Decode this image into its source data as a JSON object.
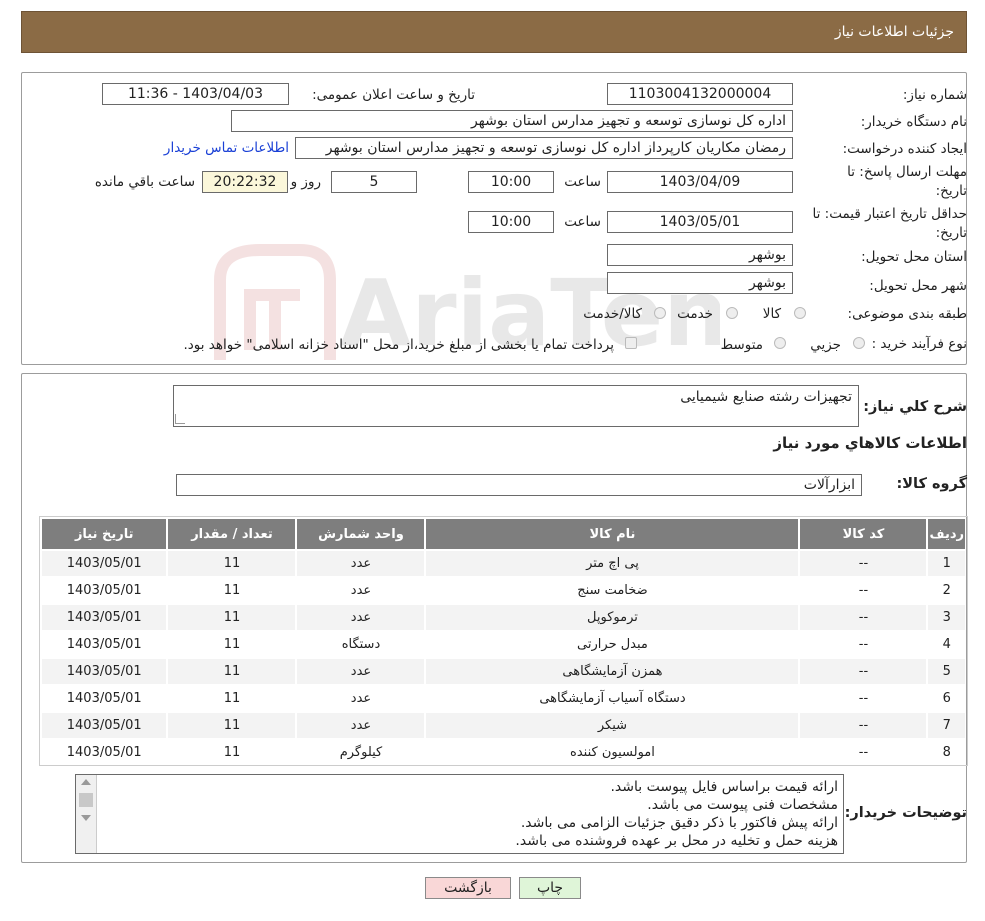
{
  "header": {
    "title": "جزئیات اطلاعات نیاز"
  },
  "form": {
    "need_number_label": "شماره نیاز:",
    "need_number": "1103004132000004",
    "announce_label": "تاریخ و ساعت اعلان عمومی:",
    "announce_value": "1403/04/03 - 11:36",
    "buyer_org_label": "نام دستگاه خریدار:",
    "buyer_org": "اداره کل نوسازی  توسعه و تجهیز مدارس استان بوشهر",
    "requester_label": "ایجاد کننده درخواست:",
    "requester": "رمضان مکاریان کارپرداز اداره کل نوسازی  توسعه و تجهیز مدارس استان بوشهر",
    "contact_link": "اطلاعات تماس خریدار",
    "deadline_label_1": "مهلت ارسال پاسخ: تا",
    "deadline_label_2": "تاریخ:",
    "deadline_date": "1403/04/09",
    "time_label": "ساعت",
    "deadline_time": "10:00",
    "days_value": "5",
    "days_label": "روز و",
    "remaining_time": "20:22:32",
    "remaining_label": "ساعت باقي مانده",
    "min_price_label_1": "حداقل تاریخ اعتبار قیمت: تا",
    "min_price_label_2": "تاریخ:",
    "min_price_date": "1403/05/01",
    "min_price_time": "10:00",
    "province_label": "استان محل تحویل:",
    "province": "بوشهر",
    "city_label": "شهر محل تحویل:",
    "city": "بوشهر",
    "category_label": "طبقه بندی موضوعی:",
    "category_options": [
      "کالا",
      "خدمت",
      "کالا/خدمت"
    ],
    "process_label": "نوع فرآیند خرید :",
    "process_options": [
      "جزیي",
      "متوسط"
    ],
    "process_note": "پرداخت تمام یا بخشی از مبلغ خرید،از محل \"اسناد خزانه اسلامی\" خواهد بود."
  },
  "details": {
    "general_label": "شرح کلي نیاز:",
    "general_value": "تجهیزات رشته صنایع شیمیایی",
    "goods_info_title": "اطلاعات کالاهاي مورد نیاز",
    "group_label": "گروه کالا:",
    "group_value": "ابزارآلات"
  },
  "table": {
    "headers": [
      "ردیف",
      "کد کالا",
      "نام کالا",
      "واحد شمارش",
      "تعداد / مقدار",
      "تاریخ نیاز"
    ],
    "rows": [
      [
        "1",
        "--",
        "پی اچ متر",
        "عدد",
        "11",
        "1403/05/01"
      ],
      [
        "2",
        "--",
        "ضخامت سنج",
        "عدد",
        "11",
        "1403/05/01"
      ],
      [
        "3",
        "--",
        "ترموکوپل",
        "عدد",
        "11",
        "1403/05/01"
      ],
      [
        "4",
        "--",
        "مبدل حرارتی",
        "دستگاه",
        "11",
        "1403/05/01"
      ],
      [
        "5",
        "--",
        "همزن آزمایشگاهی",
        "عدد",
        "11",
        "1403/05/01"
      ],
      [
        "6",
        "--",
        "دستگاه آسیاب آزمایشگاهی",
        "عدد",
        "11",
        "1403/05/01"
      ],
      [
        "7",
        "--",
        "شیکر",
        "عدد",
        "11",
        "1403/05/01"
      ],
      [
        "8",
        "--",
        "امولسیون کننده",
        "کیلوگرم",
        "11",
        "1403/05/01"
      ]
    ]
  },
  "buyer_notes": {
    "label": "توضیحات خریدار:",
    "lines": [
      "ارائه قیمت براساس فایل پیوست باشد.",
      "مشخصات فنی پیوست می باشد.",
      "ارائه پیش فاکتور با ذکر دقیق جزئیات الزامی می باشد.",
      "هزینه حمل و تخلیه در محل بر عهده فروشنده می باشد."
    ]
  },
  "buttons": {
    "print": "چاپ",
    "back": "بازگشت"
  },
  "watermark": {
    "text": "AriaTender.neT"
  },
  "colors": {
    "header_bg": "#8b6b45",
    "table_header_bg": "#7e7e7e",
    "timer_bg": "#fbf7da",
    "link": "#1a40d6",
    "back_bg": "#f9d7d7",
    "print_bg": "#dff5d8"
  }
}
